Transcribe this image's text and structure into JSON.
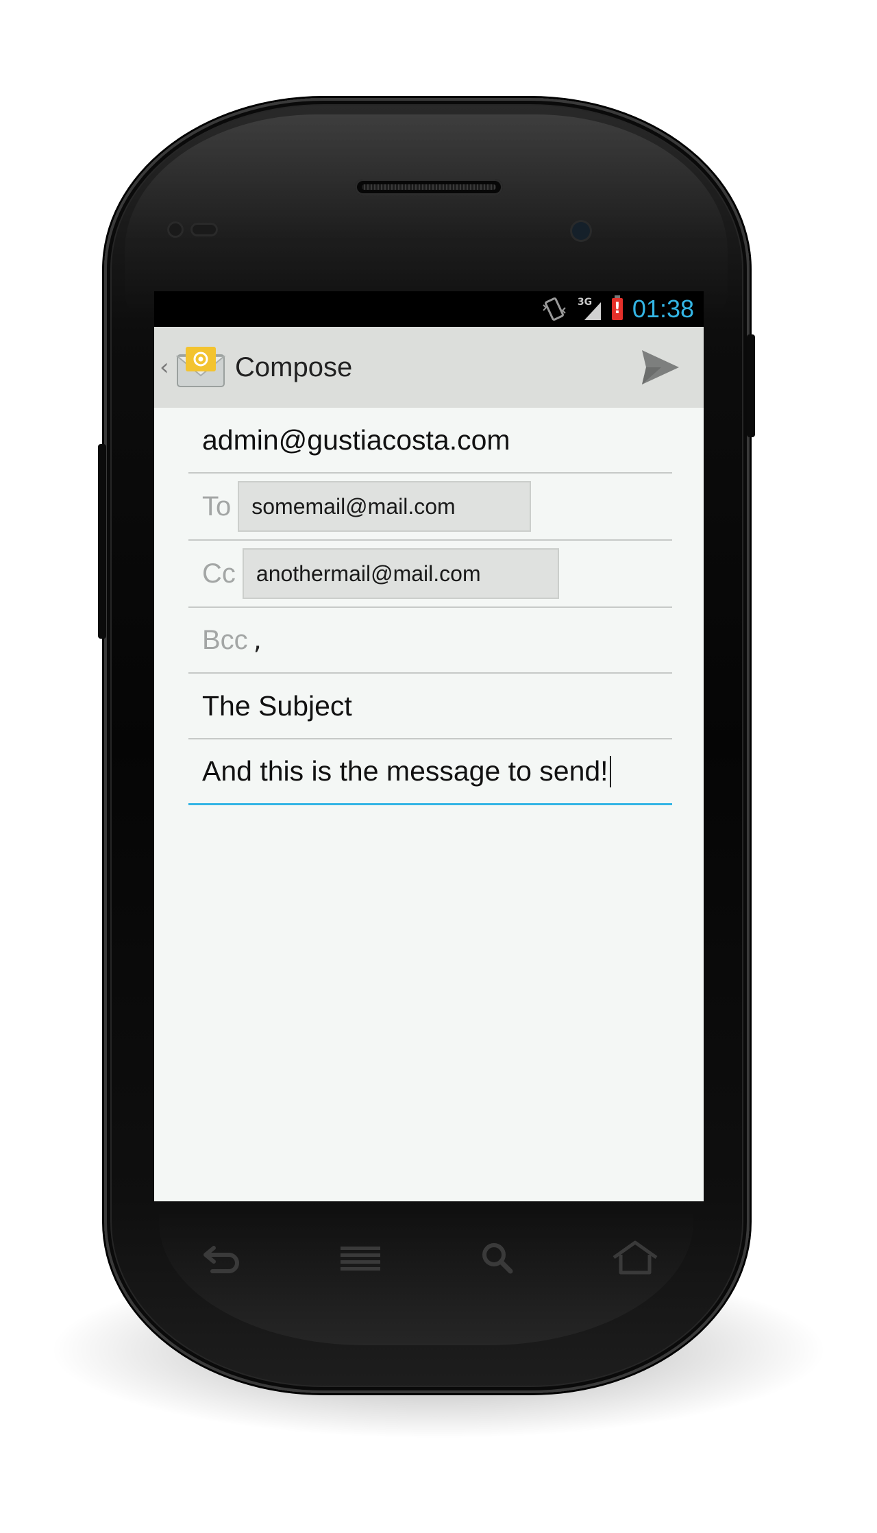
{
  "status_bar": {
    "time": "01:38",
    "network_label": "3G",
    "battery_alert": "!",
    "icons": [
      "vibrate-icon",
      "signal-3g-icon",
      "battery-alert-icon"
    ]
  },
  "action_bar": {
    "title": "Compose",
    "app_icon": "email-app-icon",
    "send_icon": "send-icon"
  },
  "compose": {
    "from": "admin@gustiacosta.com",
    "to_label": "To",
    "to_chip": "somemail@mail.com",
    "cc_label": "Cc",
    "cc_chip": "anothermail@mail.com",
    "bcc_label": "Bcc",
    "bcc_value": ",",
    "subject": "The Subject",
    "body": "And this is the message to send!"
  },
  "nav_keys": [
    "back-icon",
    "menu-icon",
    "search-icon",
    "home-icon"
  ],
  "colors": {
    "accent": "#33b5e5",
    "action_bar_bg": "#dcdedb",
    "content_bg": "#f4f7f5",
    "chip_bg": "#dfe1df"
  }
}
